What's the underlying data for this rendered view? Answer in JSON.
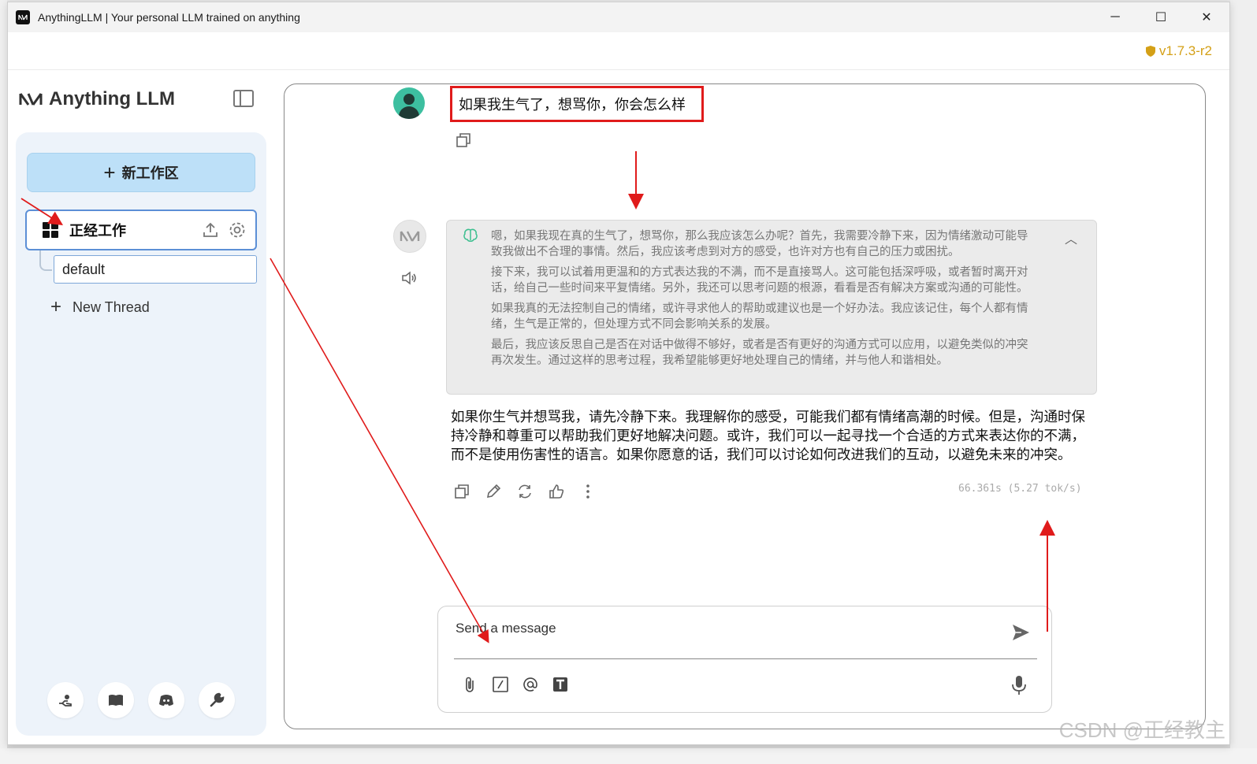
{
  "window": {
    "title": "AnythingLLM | Your personal LLM trained on anything",
    "minimize": "─",
    "maximize": "☐",
    "close": "✕"
  },
  "appbar": {
    "version": "v1.7.3-r2"
  },
  "sidebar": {
    "logo_text": "Anything LLM",
    "new_workspace": "新工作区",
    "workspace_name": "正经工作",
    "thread_default": "default",
    "new_thread": "New Thread",
    "footer_icons": [
      "support-hand-icon",
      "book-icon",
      "discord-icon",
      "wrench-icon"
    ]
  },
  "chat": {
    "user_message": "如果我生气了，想骂你，你会怎么样",
    "thought_paragraphs": [
      "嗯，如果我现在真的生气了，想骂你，那么我应该怎么办呢？首先，我需要冷静下来，因为情绪激动可能导致我做出不合理的事情。然后，我应该考虑到对方的感受，也许对方也有自己的压力或困扰。",
      "接下来，我可以试着用更温和的方式表达我的不满，而不是直接骂人。这可能包括深呼吸，或者暂时离开对话，给自己一些时间来平复情绪。另外，我还可以思考问题的根源，看看是否有解决方案或沟通的可能性。",
      "如果我真的无法控制自己的情绪，或许寻求他人的帮助或建议也是一个好办法。我应该记住，每个人都有情绪，生气是正常的，但处理方式不同会影响关系的发展。",
      "最后，我应该反思自己是否在对话中做得不够好，或者是否有更好的沟通方式可以应用，以避免类似的冲突再次发生。通过这样的思考过程，我希望能够更好地处理自己的情绪，并与他人和谐相处。"
    ],
    "answer": "如果你生气并想骂我，请先冷静下来。我理解你的感受，可能我们都有情绪高潮的时候。但是，沟通时保持冷静和尊重可以帮助我们更好地解决问题。或许，我们可以一起寻找一个合适的方式来表达你的不满，而不是使用伤害性的语言。如果你愿意的话，我们可以讨论如何改进我们的互动，以避免未来的冲突。",
    "stats": "66.361s (5.27 tok/s)",
    "collapse_glyph": "︿"
  },
  "composer": {
    "placeholder": "Send a message"
  },
  "watermark": "CSDN @正经教主",
  "colors": {
    "accent": "#bde0f8",
    "annotation_red": "#e01b1b",
    "version_gold": "#d4a017"
  }
}
